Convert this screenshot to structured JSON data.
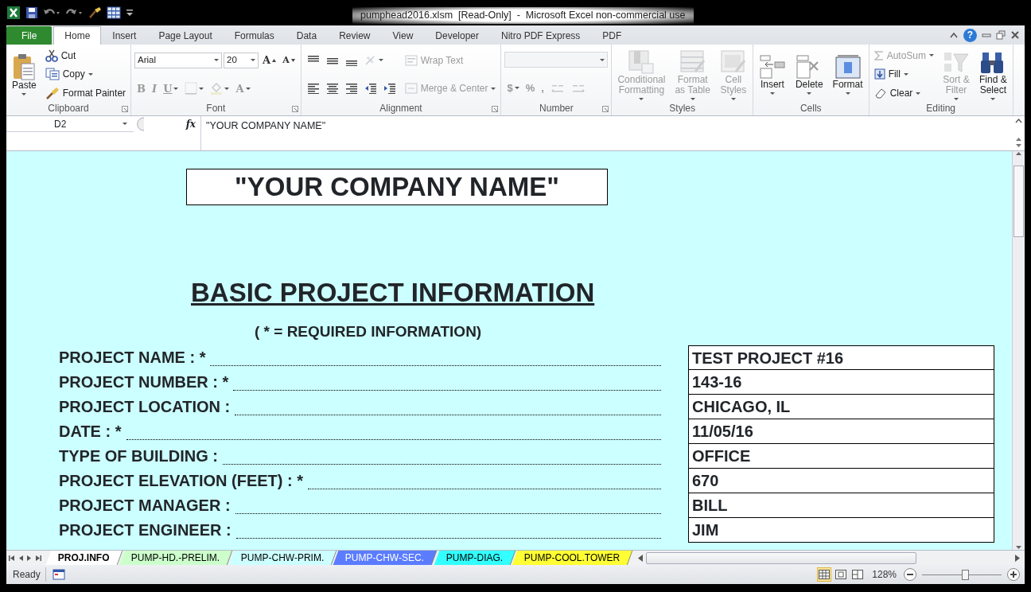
{
  "window": {
    "title": "pumphead2016.xlsm  [Read-Only]  -  Microsoft Excel non-commercial use",
    "help": "?"
  },
  "ribbon_tabs": [
    {
      "label": "File",
      "kind": "file",
      "selected": false
    },
    {
      "label": "Home",
      "kind": "tab",
      "selected": true
    },
    {
      "label": "Insert",
      "kind": "tab",
      "selected": false
    },
    {
      "label": "Page Layout",
      "kind": "tab",
      "selected": false
    },
    {
      "label": "Formulas",
      "kind": "tab",
      "selected": false
    },
    {
      "label": "Data",
      "kind": "tab",
      "selected": false
    },
    {
      "label": "Review",
      "kind": "tab",
      "selected": false
    },
    {
      "label": "View",
      "kind": "tab",
      "selected": false
    },
    {
      "label": "Developer",
      "kind": "tab",
      "selected": false
    },
    {
      "label": "Nitro PDF Express",
      "kind": "tab",
      "selected": false
    },
    {
      "label": "PDF",
      "kind": "tab",
      "selected": false
    }
  ],
  "ribbon_groups": [
    {
      "label": "Clipboard",
      "launcher": true,
      "columns": [
        [
          [
            {
              "kind": "large",
              "label": "Paste",
              "dropdown": true,
              "disabled": false
            }
          ]
        ],
        [
          [
            {
              "kind": "small",
              "label": "Cut",
              "dropdown": false,
              "disabled": false
            }
          ],
          [
            {
              "kind": "small",
              "label": "Copy",
              "dropdown": true,
              "disabled": false
            }
          ],
          [
            {
              "kind": "small",
              "label": "Format Painter",
              "dropdown": false,
              "disabled": false
            }
          ]
        ]
      ]
    },
    {
      "label": "Font",
      "launcher": true,
      "columns": [
        [
          [
            {
              "kind": "combo",
              "value": "Arial",
              "wide": true,
              "disabled": false
            },
            {
              "kind": "combo",
              "value": "20",
              "wide": false,
              "disabled": false
            },
            {
              "kind": "glyph",
              "label": "A",
              "dropdown": false,
              "disabled": false
            },
            {
              "kind": "glyph",
              "label": "A",
              "dropdown": false,
              "disabled": false
            }
          ],
          [
            {
              "kind": "glyph",
              "label": "B",
              "dropdown": false,
              "disabled": true
            },
            {
              "kind": "glyph",
              "label": "I",
              "dropdown": false,
              "disabled": true
            },
            {
              "kind": "glyph",
              "label": "U",
              "dropdown": true,
              "disabled": true
            },
            {
              "kind": "icon",
              "dropdown": true,
              "disabled": true
            },
            {
              "kind": "icon",
              "dropdown": true,
              "disabled": true
            },
            {
              "kind": "glyph",
              "label": "A",
              "dropdown": true,
              "disabled": true
            }
          ]
        ]
      ]
    },
    {
      "label": "Alignment",
      "launcher": true,
      "columns": [
        [
          [
            {
              "kind": "icon",
              "dropdown": false,
              "disabled": false
            },
            {
              "kind": "icon",
              "dropdown": false,
              "disabled": false
            },
            {
              "kind": "icon",
              "dropdown": false,
              "disabled": false
            },
            {
              "kind": "icon",
              "dropdown": true,
              "disabled": true
            }
          ],
          [
            {
              "kind": "icon",
              "dropdown": false,
              "disabled": false
            },
            {
              "kind": "icon",
              "dropdown": false,
              "disabled": false
            },
            {
              "kind": "icon",
              "dropdown": false,
              "disabled": false
            },
            {
              "kind": "icon",
              "dropdown": false,
              "disabled": false
            },
            {
              "kind": "icon",
              "dropdown": false,
              "disabled": false
            }
          ]
        ],
        [
          [
            {
              "kind": "small",
              "label": "Wrap Text",
              "dropdown": false,
              "disabled": true
            }
          ],
          [
            {
              "kind": "small",
              "label": "Merge & Center",
              "dropdown": true,
              "disabled": true
            }
          ]
        ]
      ]
    },
    {
      "label": "Number",
      "launcher": true,
      "columns": [
        [
          [
            {
              "kind": "combo",
              "wide": true,
              "disabled": true
            }
          ],
          [
            {
              "kind": "glyph",
              "label": "$",
              "dropdown": true,
              "disabled": true
            },
            {
              "kind": "glyph",
              "label": "%",
              "dropdown": false,
              "disabled": true
            },
            {
              "kind": "glyph",
              "label": ",",
              "dropdown": false,
              "disabled": true
            },
            {
              "kind": "icon",
              "dropdown": false,
              "disabled": true
            },
            {
              "kind": "icon",
              "dropdown": false,
              "disabled": true
            }
          ]
        ]
      ]
    },
    {
      "label": "Styles",
      "launcher": false,
      "columns": [
        [
          [
            {
              "kind": "large",
              "label": "Conditional\nFormatting",
              "dropdown": true,
              "disabled": true
            }
          ]
        ],
        [
          [
            {
              "kind": "large",
              "label": "Format\nas Table",
              "dropdown": true,
              "disabled": true
            }
          ]
        ],
        [
          [
            {
              "kind": "large",
              "label": "Cell\nStyles",
              "dropdown": true,
              "disabled": true
            }
          ]
        ]
      ]
    },
    {
      "label": "Cells",
      "launcher": false,
      "columns": [
        [
          [
            {
              "kind": "large",
              "label": "Insert",
              "dropdown": true,
              "disabled": false
            }
          ]
        ],
        [
          [
            {
              "kind": "large",
              "label": "Delete",
              "dropdown": true,
              "disabled": false
            }
          ]
        ],
        [
          [
            {
              "kind": "large",
              "label": "Format",
              "dropdown": true,
              "disabled": false
            }
          ]
        ]
      ]
    },
    {
      "label": "Editing",
      "launcher": false,
      "columns": [
        [
          [
            {
              "kind": "small",
              "label": "AutoSum",
              "dropdown": true,
              "disabled": true
            }
          ],
          [
            {
              "kind": "small",
              "label": "Fill",
              "dropdown": true,
              "disabled": false
            }
          ],
          [
            {
              "kind": "small",
              "label": "Clear",
              "dropdown": true,
              "disabled": false
            }
          ]
        ],
        [
          [
            {
              "kind": "large",
              "label": "Sort &\nFilter",
              "dropdown": true,
              "disabled": true
            }
          ]
        ],
        [
          [
            {
              "kind": "large",
              "label": "Find &\nSelect",
              "dropdown": true,
              "disabled": false
            }
          ]
        ]
      ]
    }
  ],
  "formula_bar": {
    "name_box": "D2",
    "fx": "fx",
    "formula": "\"YOUR COMPANY NAME\""
  },
  "sheet": {
    "company": "\"YOUR COMPANY NAME\"",
    "heading": "BASIC PROJECT INFORMATION",
    "note": "( * = REQUIRED INFORMATION)",
    "fields": [
      {
        "label": "PROJECT NAME : *",
        "value": "TEST PROJECT #16"
      },
      {
        "label": "PROJECT NUMBER : *",
        "value": "143-16"
      },
      {
        "label": "PROJECT LOCATION :",
        "value": "CHICAGO, IL"
      },
      {
        "label": "DATE : *",
        "value": "11/05/16"
      },
      {
        "label": "TYPE OF BUILDING :",
        "value": "OFFICE"
      },
      {
        "label": "PROJECT ELEVATION (FEET) : *",
        "value": "670"
      },
      {
        "label": "PROJECT MANAGER :",
        "value": "BILL"
      },
      {
        "label": "PROJECT ENGINEER :",
        "value": "JIM"
      }
    ]
  },
  "sheet_tabs": [
    {
      "label": "PROJ.INFO",
      "color": "#ffffff",
      "selected": true
    },
    {
      "label": "PUMP-HD.-PRELIM.",
      "color": "#ccffcc",
      "selected": false
    },
    {
      "label": "PUMP-CHW-PRIM.",
      "color": "#ccffff",
      "selected": false
    },
    {
      "label": "PUMP-CHW-SEC.",
      "color": "#5b7cff",
      "selected": false
    },
    {
      "label": "PUMP-DIAG.",
      "color": "#33ffff",
      "selected": false
    },
    {
      "label": "PUMP-COOL.TOWER",
      "color": "#ffff33",
      "selected": false
    }
  ],
  "status_bar": {
    "status": "Ready",
    "views": [
      {
        "selected": true
      },
      {
        "selected": false
      },
      {
        "selected": false
      }
    ],
    "zoom": "128%",
    "zoom_slider": {
      "level": 0.54
    }
  }
}
